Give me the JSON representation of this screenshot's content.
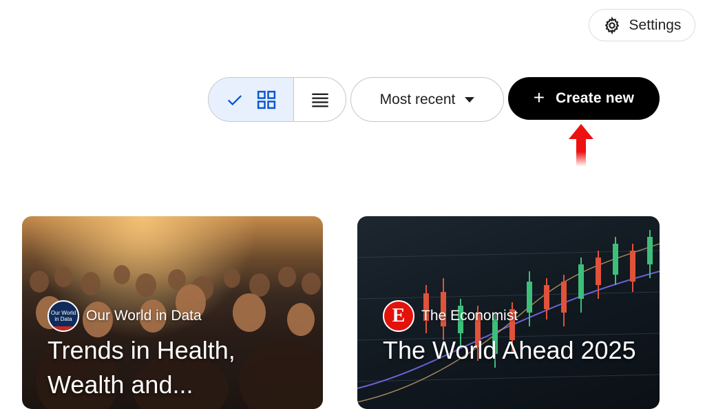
{
  "header": {
    "settings_label": "Settings",
    "settings_icon": "gear-icon"
  },
  "toolbar": {
    "view_toggle": {
      "selected": "grid",
      "grid_icon": "grid-view-icon",
      "list_icon": "list-view-icon",
      "check_icon": "checkmark-icon"
    },
    "sort_label": "Most recent",
    "create_label": "Create new",
    "create_icon": "plus-icon"
  },
  "annotation": {
    "arrow_color": "#ee1111",
    "arrow_icon": "up-arrow-icon"
  },
  "cards": [
    {
      "source": "Our World in Data",
      "logo_text": "Our World in Data",
      "title": "Trends in Health, Wealth and...",
      "image": "crowd-photo"
    },
    {
      "source": "The Economist",
      "logo_text": "E",
      "title": "The World Ahead 2025",
      "image": "candlestick-chart-photo"
    }
  ],
  "colors": {
    "accent_selected_bg": "#e8f0fe",
    "icon_blue": "#0b57d0",
    "create_bg": "#000000",
    "economist_red": "#e3120b",
    "owid_navy": "#0f2b5b"
  }
}
